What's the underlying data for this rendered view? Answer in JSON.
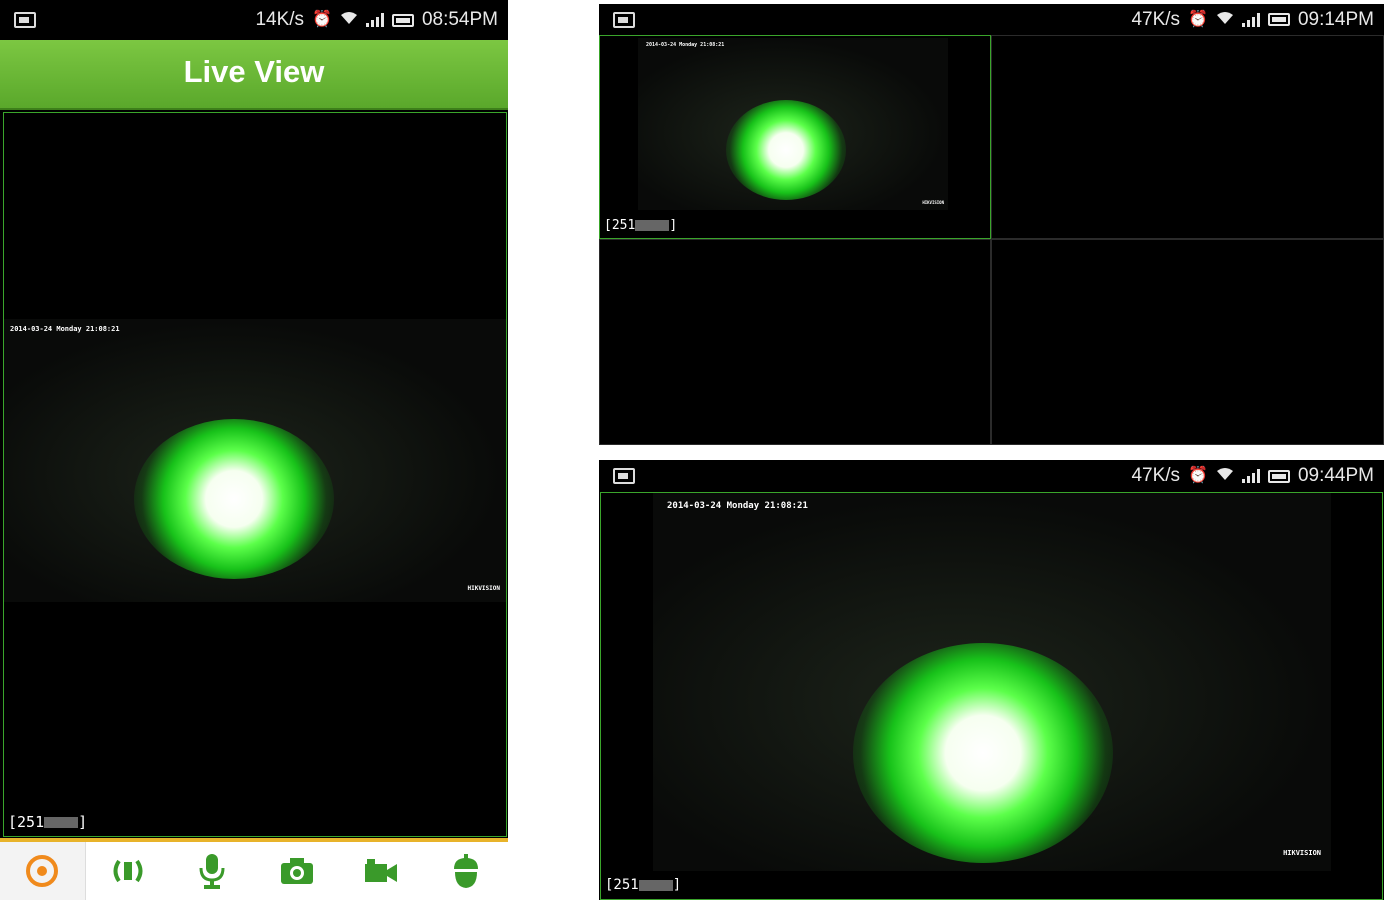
{
  "phone_portrait": {
    "status": {
      "speed": "14K/s",
      "time": "08:54PM"
    },
    "header": {
      "title": "Live View"
    },
    "feed": {
      "timestamp": "2014-03-24 Monday 21:08:21",
      "brand": "HIKVISION"
    },
    "channel_label": "[251",
    "channel_label_end": "]",
    "toolbar": {
      "items": [
        {
          "name": "ptz",
          "icon": "ptz-target-icon"
        },
        {
          "name": "audio",
          "icon": "speaker-icon"
        },
        {
          "name": "talk",
          "icon": "microphone-icon"
        },
        {
          "name": "snapshot",
          "icon": "camera-icon"
        },
        {
          "name": "record",
          "icon": "video-camera-icon"
        },
        {
          "name": "more",
          "icon": "acorn-icon"
        }
      ]
    }
  },
  "phone_quad": {
    "status": {
      "speed": "47K/s",
      "time": "09:14PM"
    },
    "feed": {
      "timestamp": "2014-03-24 Monday 21:08:21",
      "brand": "HIKVISION"
    },
    "channel_label": "[251",
    "channel_label_end": "]"
  },
  "phone_landscape": {
    "status": {
      "speed": "47K/s",
      "time": "09:44PM"
    },
    "feed": {
      "timestamp": "2014-03-24 Monday 21:08:21",
      "brand": "HIKVISION"
    },
    "channel_label": "[251",
    "channel_label_end": "]"
  },
  "colors": {
    "accent_green": "#5aa82b",
    "toolbar_icon": "#3a9a2a",
    "ptz_orange": "#f08a1c",
    "divider_gold": "#e8b32a"
  }
}
